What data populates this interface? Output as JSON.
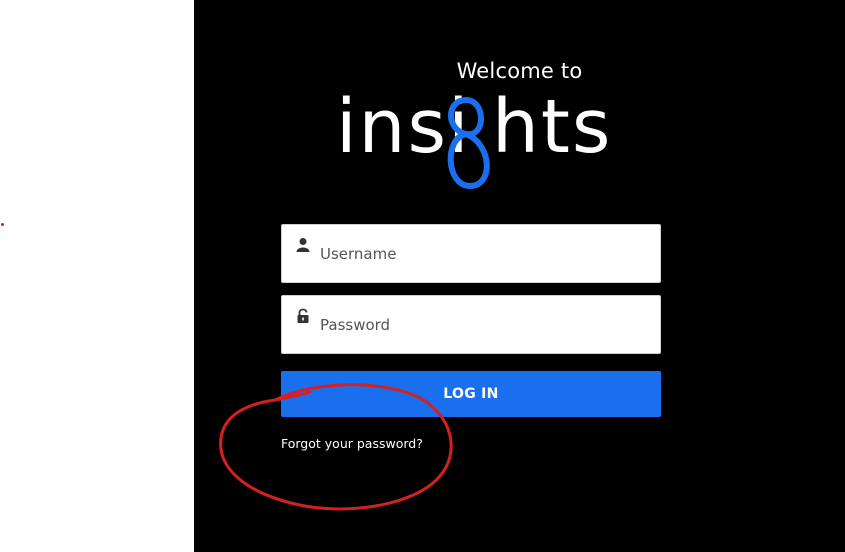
{
  "welcome_text": "Welcome to",
  "logo": {
    "text_before": "insi",
    "text_after": "hts",
    "accent_glyph": "g",
    "accent_color": "#1a6fef"
  },
  "form": {
    "username": {
      "placeholder": "Username",
      "value": "",
      "icon": "user-icon"
    },
    "password": {
      "placeholder": "Password",
      "value": "",
      "icon": "lock-icon"
    },
    "login_label": "LOG IN",
    "forgot_label": "Forgot your password?"
  },
  "colors": {
    "panel_bg": "#000000",
    "button_bg": "#1a6fef",
    "annotation": "#d62020"
  }
}
